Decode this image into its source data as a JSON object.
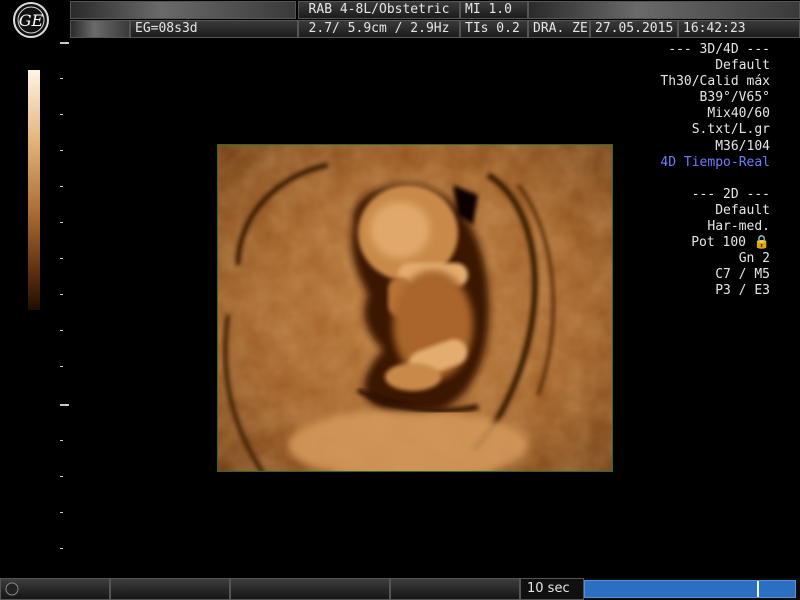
{
  "header": {
    "logo_icon": "ge-logo",
    "patient_id": "",
    "gestational_age": "EG=08s3d",
    "probe_application": "RAB 4-8L/Obstetric",
    "depth_freq": "2.7/ 5.9cm / 2.9Hz",
    "mi": "MI  1.0",
    "tis": "TIs  0.2",
    "operator": "DRA. ZE",
    "date": "27.05.2015",
    "time": "16:42:23"
  },
  "params": [
    "--- 3D/4D ---",
    "Default",
    "Th30/Calid máx",
    "B39°/V65°",
    "Mix40/60",
    "S.txt/L.gr",
    "M36/104",
    "4D Tiempo-Real",
    "",
    "--- 2D ---",
    "Default",
    "Har-med.",
    "Pot 100 🔒",
    "Gn  2",
    "C7 / M5",
    "P3 / E3"
  ],
  "footer": {
    "cine_label": "10 sec",
    "cine_position": 0.82
  },
  "colors": {
    "highlight": "#6f7cff",
    "cine_bar": "#2a6fc1",
    "tissue": "#a8642a"
  }
}
